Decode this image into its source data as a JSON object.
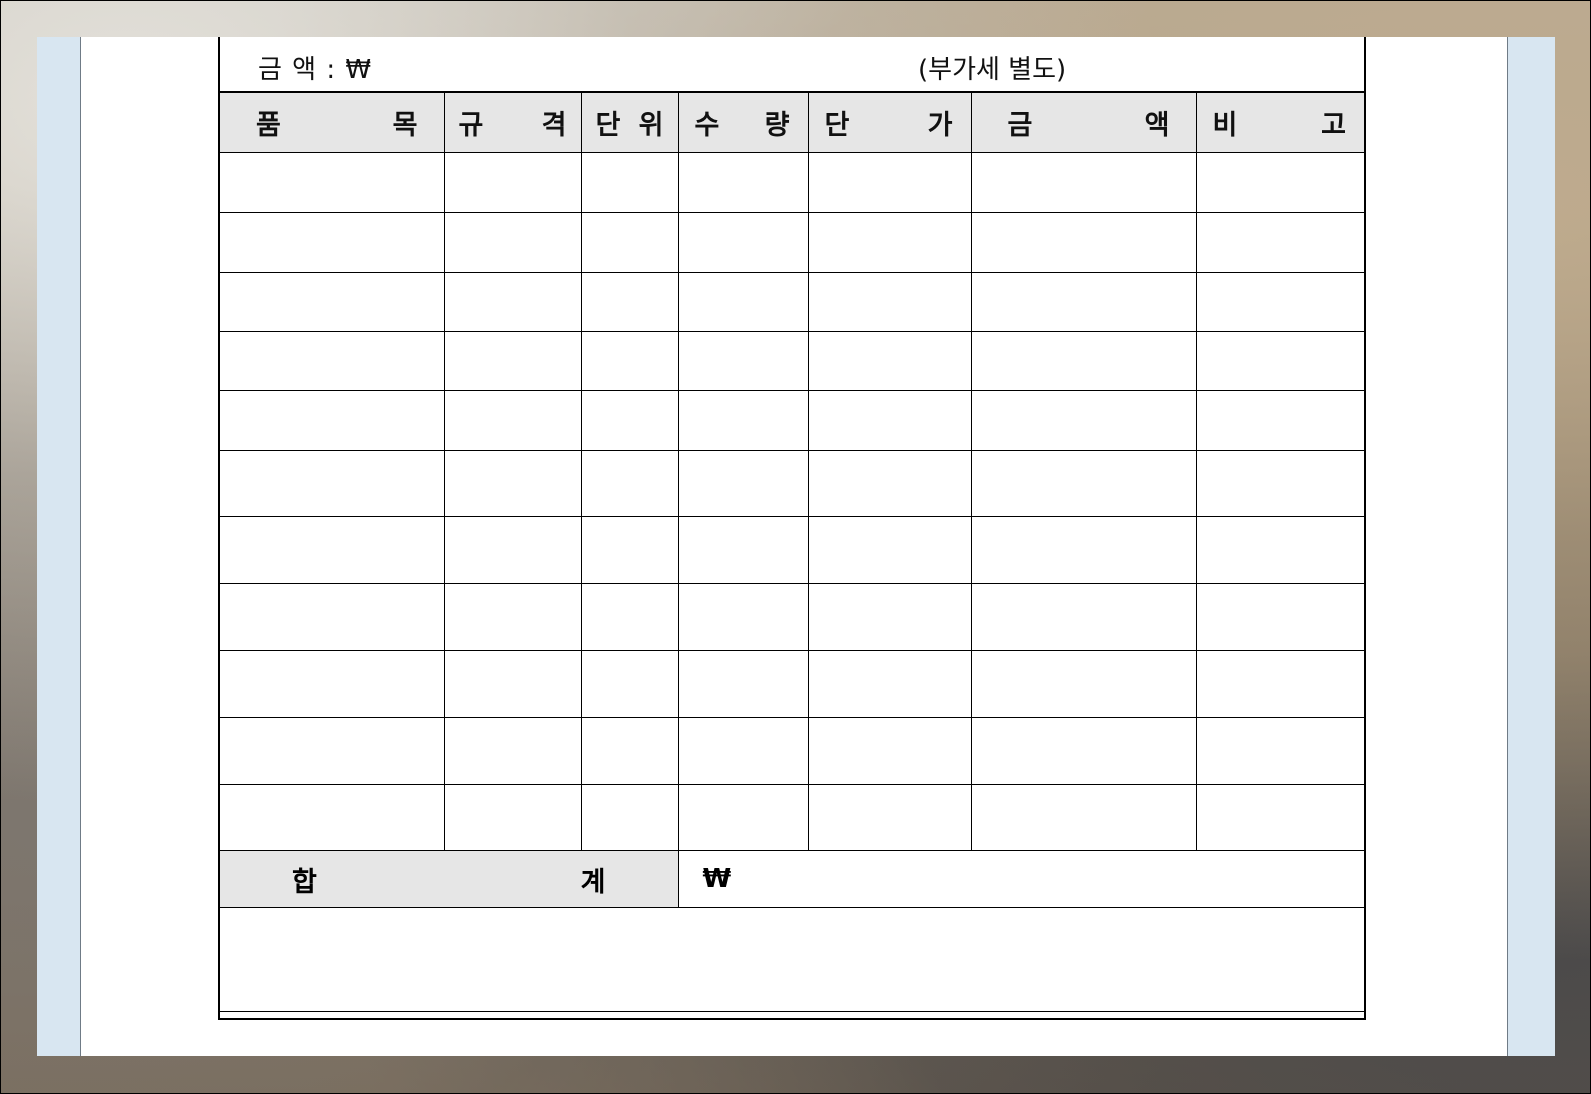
{
  "form": {
    "amount_label": "금    액 : ₩",
    "vat_note": "(부가세 별도)",
    "columns": [
      {
        "left": "품",
        "right": "목"
      },
      {
        "left": "규",
        "right": "격"
      },
      {
        "left": "단",
        "right": "위"
      },
      {
        "left": "수",
        "right": "량"
      },
      {
        "left": "단",
        "right": "가"
      },
      {
        "left": "금",
        "right": "액"
      },
      {
        "left": "비",
        "right": "고"
      }
    ],
    "total": {
      "label_left": "합",
      "label_right": "계",
      "value": "₩"
    }
  }
}
